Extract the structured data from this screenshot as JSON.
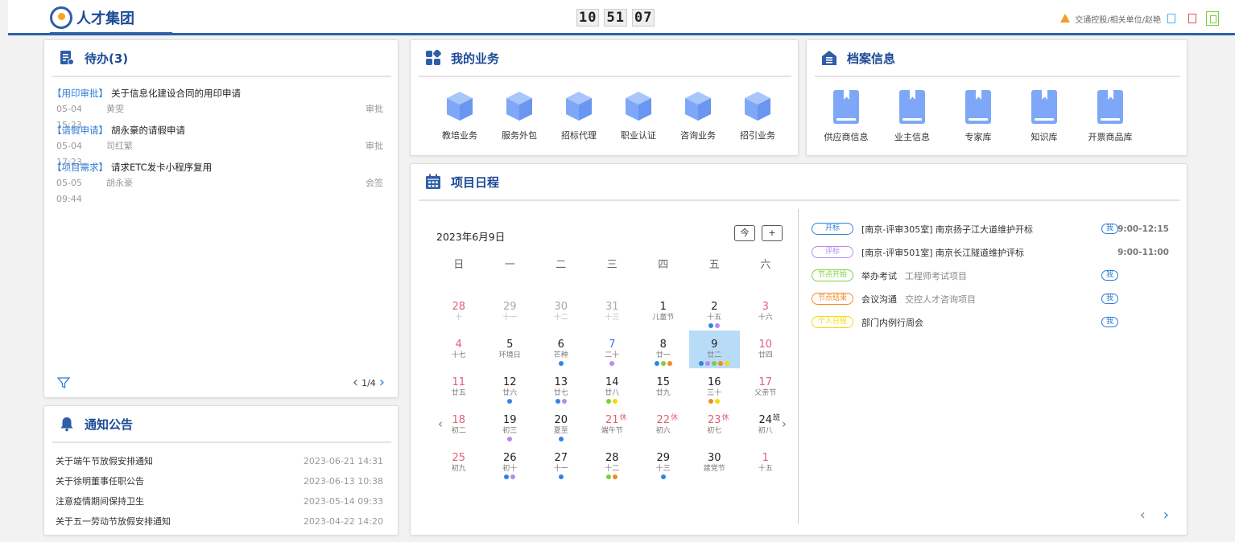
{
  "header": {
    "logo_text": "人才集团",
    "clock": [
      "10",
      "51",
      "07"
    ],
    "org_text": "交通控股/相关单位/赵艳"
  },
  "todo": {
    "title": "待办(3)",
    "items": [
      {
        "tag": "【用印审批】",
        "title": "关于信息化建设合同的用印申请",
        "time": "05-04 15:23",
        "person": "黄雯",
        "type": "审批"
      },
      {
        "tag": "【请假申请】",
        "title": "胡永豪的请假申请",
        "time": "05-04 17:23",
        "person": "司红繁",
        "type": "审批"
      },
      {
        "tag": "【项目需求】",
        "title": "请求ETC发卡小程序复用",
        "time": "05-05 09:44",
        "person": "胡永豪",
        "type": "会签"
      }
    ],
    "page": "1/4"
  },
  "notice": {
    "title": "通知公告",
    "items": [
      {
        "title": "关于端午节放假安排通知",
        "date": "2023-06-21 14:31"
      },
      {
        "title": "关于徐明董事任职公告",
        "date": "2023-06-13 10:38"
      },
      {
        "title": "注意疫情期间保持卫生",
        "date": "2023-05-14 09:33"
      },
      {
        "title": "关于五一劳动节放假安排通知",
        "date": "2023-04-22 14:20"
      }
    ]
  },
  "business": {
    "title": "我的业务",
    "items": [
      "教培业务",
      "服务外包",
      "招标代理",
      "职业认证",
      "咨询业务",
      "招引业务"
    ]
  },
  "archive": {
    "title": "档案信息",
    "items": [
      "供应商信息",
      "业主信息",
      "专家库",
      "知识库",
      "开票商品库"
    ]
  },
  "schedule": {
    "title": "项目日程",
    "date_label": "2023年6月9日",
    "today_btn": "今",
    "add_btn": "+",
    "weekdays": [
      "日",
      "一",
      "二",
      "三",
      "四",
      "五",
      "六"
    ],
    "weeks": [
      [
        {
          "d": "28",
          "s": "十",
          "muted": true,
          "we": true
        },
        {
          "d": "29",
          "s": "十一",
          "muted": true
        },
        {
          "d": "30",
          "s": "十二",
          "muted": true
        },
        {
          "d": "31",
          "s": "十三",
          "muted": true
        },
        {
          "d": "1",
          "s": "儿童节"
        },
        {
          "d": "2",
          "s": "十五",
          "dots": [
            "#2e86de",
            "#b48cf0"
          ]
        },
        {
          "d": "3",
          "s": "十六",
          "we": true
        }
      ],
      [
        {
          "d": "4",
          "s": "十七",
          "we": true
        },
        {
          "d": "5",
          "s": "环境日"
        },
        {
          "d": "6",
          "s": "芒种",
          "dots": [
            "#2e86de"
          ]
        },
        {
          "d": "7",
          "s": "二十",
          "blue": true,
          "dots": [
            "#b48cf0"
          ]
        },
        {
          "d": "8",
          "s": "廿一",
          "dots": [
            "#2e86de",
            "#7bd03a",
            "#f08a24"
          ]
        },
        {
          "d": "9",
          "s": "廿二",
          "selected": true,
          "dots": [
            "#2e86de",
            "#b48cf0",
            "#7bd03a",
            "#f08a24",
            "#f5d90a"
          ]
        },
        {
          "d": "10",
          "s": "廿四",
          "we": true
        }
      ],
      [
        {
          "d": "11",
          "s": "廿五",
          "we": true
        },
        {
          "d": "12",
          "s": "廿六",
          "dots": [
            "#2e86de"
          ]
        },
        {
          "d": "13",
          "s": "廿七",
          "dots": [
            "#2e86de",
            "#b48cf0"
          ]
        },
        {
          "d": "14",
          "s": "廿八",
          "dots": [
            "#7bd03a",
            "#f5d90a"
          ]
        },
        {
          "d": "15",
          "s": "廿九"
        },
        {
          "d": "16",
          "s": "三十",
          "dots": [
            "#f08a24",
            "#f5d90a"
          ]
        },
        {
          "d": "17",
          "s": "父亲节",
          "we": true
        }
      ],
      [
        {
          "d": "18",
          "s": "初二",
          "we": true
        },
        {
          "d": "19",
          "s": "初三",
          "dots": [
            "#b48cf0"
          ]
        },
        {
          "d": "20",
          "s": "夏至",
          "dots": [
            "#2e86de"
          ]
        },
        {
          "d": "21",
          "s": "端午节",
          "red": true,
          "sup": "休"
        },
        {
          "d": "22",
          "s": "初六",
          "red": true,
          "sup": "休"
        },
        {
          "d": "23",
          "s": "初七",
          "red": true,
          "sup": "休"
        },
        {
          "d": "24",
          "s": "初八",
          "sup": "班"
        }
      ],
      [
        {
          "d": "25",
          "s": "初九",
          "we": true
        },
        {
          "d": "26",
          "s": "初十",
          "dots": [
            "#2e86de",
            "#b48cf0"
          ]
        },
        {
          "d": "27",
          "s": "十一",
          "dots": [
            "#2e86de"
          ]
        },
        {
          "d": "28",
          "s": "十二",
          "dots": [
            "#7bd03a",
            "#f08a24"
          ]
        },
        {
          "d": "29",
          "s": "十三",
          "dots": [
            "#2e86de"
          ]
        },
        {
          "d": "30",
          "s": "建党节"
        },
        {
          "d": "1",
          "s": "十五",
          "we": true
        }
      ]
    ],
    "events": [
      {
        "tag": "开标",
        "color": "#2e86de",
        "title": "[南京-评审305室] 南京扬子江大道维护开标",
        "sub": "",
        "me": "我",
        "time": "9:00-12:15"
      },
      {
        "tag": "评标",
        "color": "#b48cf0",
        "title": "[南京-评审501室] 南京长江隧道维护评标",
        "sub": "",
        "me": "",
        "time": "9:00-11:00"
      },
      {
        "tag": "节点开始",
        "color": "#7bd03a",
        "title": "举办考试",
        "sub": "工程师考试项目",
        "me": "我",
        "time": ""
      },
      {
        "tag": "节点结束",
        "color": "#f08a24",
        "title": "会议沟通",
        "sub": "交控人才咨询项目",
        "me": "我",
        "time": ""
      },
      {
        "tag": "个人日程",
        "color": "#f5d90a",
        "title": "部门内例行周会",
        "sub": "",
        "me": "我",
        "time": ""
      }
    ]
  }
}
